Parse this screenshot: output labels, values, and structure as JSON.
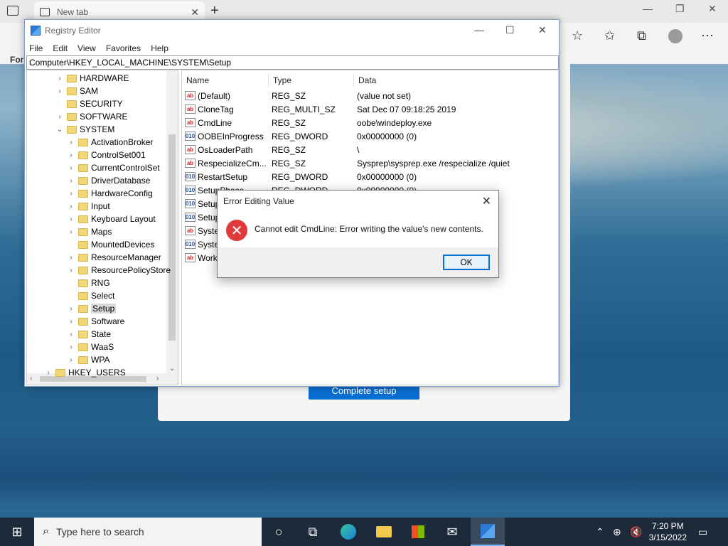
{
  "browser": {
    "tab_title": "New tab",
    "new_tab": "+",
    "favorites_bar_text": "For"
  },
  "edge_page": {
    "complete_button": "Complete setup"
  },
  "regedit": {
    "title": "Registry Editor",
    "menu": [
      "File",
      "Edit",
      "View",
      "Favorites",
      "Help"
    ],
    "address": "Computer\\HKEY_LOCAL_MACHINE\\SYSTEM\\Setup",
    "tree": [
      {
        "label": "HARDWARE",
        "chev": "›"
      },
      {
        "label": "SAM",
        "chev": "›"
      },
      {
        "label": "SECURITY",
        "chev": ""
      },
      {
        "label": "SOFTWARE",
        "chev": "›"
      },
      {
        "label": "SYSTEM",
        "chev": "⌄"
      },
      {
        "label": "ActivationBroker",
        "chev": "›"
      },
      {
        "label": "ControlSet001",
        "chev": "›"
      },
      {
        "label": "CurrentControlSet",
        "chev": "›"
      },
      {
        "label": "DriverDatabase",
        "chev": "›"
      },
      {
        "label": "HardwareConfig",
        "chev": "›"
      },
      {
        "label": "Input",
        "chev": "›"
      },
      {
        "label": "Keyboard Layout",
        "chev": "›"
      },
      {
        "label": "Maps",
        "chev": "›"
      },
      {
        "label": "MountedDevices",
        "chev": ""
      },
      {
        "label": "ResourceManager",
        "chev": "›"
      },
      {
        "label": "ResourcePolicyStore",
        "chev": "›"
      },
      {
        "label": "RNG",
        "chev": ""
      },
      {
        "label": "Select",
        "chev": ""
      },
      {
        "label": "Setup",
        "chev": "›"
      },
      {
        "label": "Software",
        "chev": "›"
      },
      {
        "label": "State",
        "chev": "›"
      },
      {
        "label": "WaaS",
        "chev": "›"
      },
      {
        "label": "WPA",
        "chev": "›"
      },
      {
        "label": "HKEY_USERS",
        "chev": "›"
      }
    ],
    "columns": {
      "name": "Name",
      "type": "Type",
      "data": "Data"
    },
    "values": [
      {
        "icon": "ab",
        "name": "(Default)",
        "type": "REG_SZ",
        "data": "(value not set)"
      },
      {
        "icon": "ab",
        "name": "CloneTag",
        "type": "REG_MULTI_SZ",
        "data": "Sat Dec 07 09:18:25 2019"
      },
      {
        "icon": "ab",
        "name": "CmdLine",
        "type": "REG_SZ",
        "data": "oobe\\windeploy.exe"
      },
      {
        "icon": "010",
        "name": "OOBEInProgress",
        "type": "REG_DWORD",
        "data": "0x00000000 (0)"
      },
      {
        "icon": "ab",
        "name": "OsLoaderPath",
        "type": "REG_SZ",
        "data": "\\"
      },
      {
        "icon": "ab",
        "name": "RespecializeCm...",
        "type": "REG_SZ",
        "data": "Sysprep\\sysprep.exe /respecialize /quiet"
      },
      {
        "icon": "010",
        "name": "RestartSetup",
        "type": "REG_DWORD",
        "data": "0x00000000 (0)"
      },
      {
        "icon": "010",
        "name": "SetupPhase",
        "type": "REG_DWORD",
        "data": "0x00000000 (0)"
      },
      {
        "icon": "010",
        "name": "Setup",
        "type": "",
        "data": ""
      },
      {
        "icon": "010",
        "name": "Setup",
        "type": "",
        "data": ""
      },
      {
        "icon": "ab",
        "name": "Syste",
        "type": "",
        "data": ""
      },
      {
        "icon": "010",
        "name": "Syste",
        "type": "",
        "data": ""
      },
      {
        "icon": "ab",
        "name": "Work",
        "type": "",
        "data": ""
      }
    ]
  },
  "dialog": {
    "title": "Error Editing Value",
    "message": "Cannot edit CmdLine:  Error writing the value's new contents.",
    "ok": "OK"
  },
  "taskbar": {
    "search_placeholder": "Type here to search",
    "time": "7:20 PM",
    "date": "3/15/2022"
  }
}
